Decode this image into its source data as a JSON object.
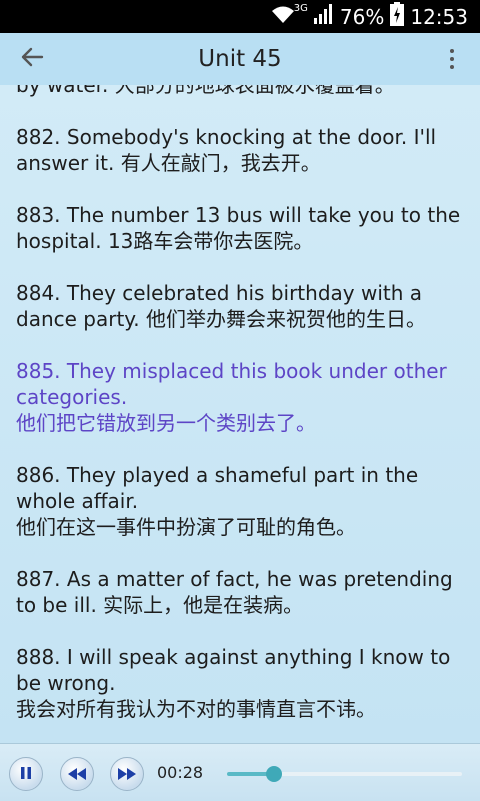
{
  "status_bar": {
    "network_type": "3G",
    "battery": "76%",
    "time": "12:53"
  },
  "action_bar": {
    "title": "Unit 45",
    "back_icon": "arrow-left-icon",
    "menu_icon": "overflow-menu-icon"
  },
  "content": {
    "partial_top": "by water. 大部分的地球表面被水覆盖着。",
    "entries": [
      {
        "text": "882. Somebody's knocking at the door. I'll answer it. 有人在敲门，我去开。",
        "active": false
      },
      {
        "text": "883. The number 13 bus will take you to the hospital. 13路车会带你去医院。",
        "active": false
      },
      {
        "text": "884. They celebrated his birthday with a dance party. 他们举办舞会来祝贺他的生日。",
        "active": false
      },
      {
        "text": "885. They misplaced this book under other categories.\n他们把它错放到另一个类别去了。",
        "active": true
      },
      {
        "text": "886. They played a shameful part in the whole affair.\n他们在这一事件中扮演了可耻的角色。",
        "active": false
      },
      {
        "text": "887. As a matter of fact, he was pretending to be ill. 实际上，他是在装病。",
        "active": false
      },
      {
        "text": "888. I will speak against anything I know to be wrong.\n我会对所有我认为不对的事情直言不讳。",
        "active": false
      }
    ],
    "active_color": "#5d45c6"
  },
  "player": {
    "elapsed": "00:28",
    "progress": 0.2
  }
}
